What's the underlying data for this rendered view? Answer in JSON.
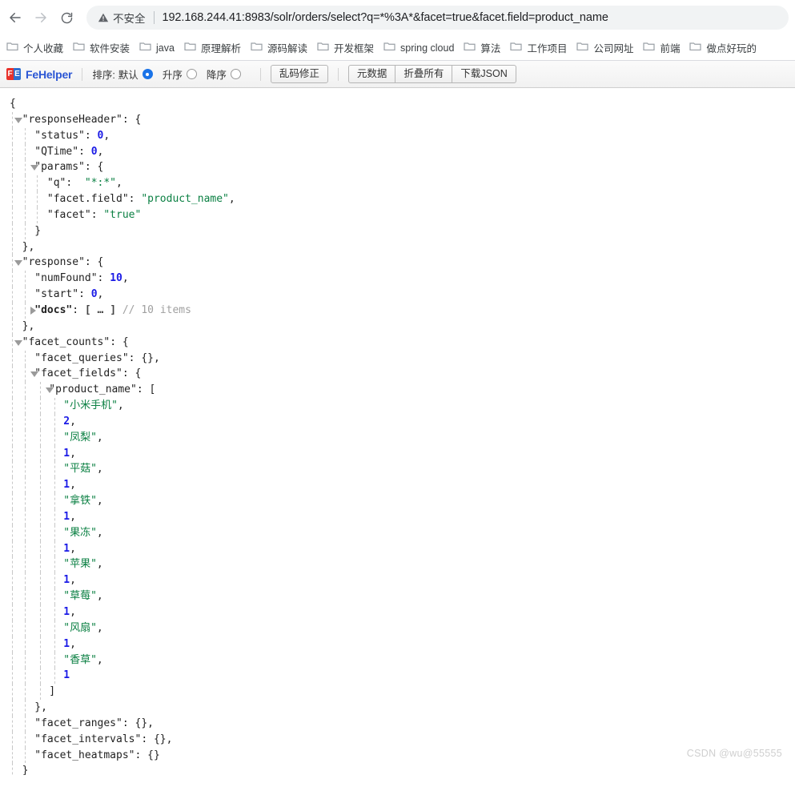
{
  "browser": {
    "back_icon": "back-arrow-icon",
    "forward_icon": "forward-arrow-icon",
    "reload_icon": "reload-icon",
    "security_text": "不安全",
    "url": "192.168.244.41:8983/solr/orders/select?q=*%3A*&facet=true&facet.field=product_name",
    "url_host": "192.168.244.41",
    "url_rest": ":8983/solr/orders/select?q=*%3A*&facet=true&facet.field=product_name"
  },
  "bookmarks": [
    {
      "label": "个人收藏"
    },
    {
      "label": "软件安装"
    },
    {
      "label": "java"
    },
    {
      "label": "原理解析"
    },
    {
      "label": "源码解读"
    },
    {
      "label": "开发框架"
    },
    {
      "label": "spring cloud"
    },
    {
      "label": "算法"
    },
    {
      "label": "工作项目"
    },
    {
      "label": "公司网址"
    },
    {
      "label": "前端"
    },
    {
      "label": "做点好玩的"
    }
  ],
  "fehelper": {
    "logo_f": "F",
    "logo_e": "E",
    "brand": "FeHelper",
    "sort_label": "排序:",
    "sort_options": [
      {
        "label": "默认",
        "checked": true
      },
      {
        "label": "升序",
        "checked": false
      },
      {
        "label": "降序",
        "checked": false
      }
    ],
    "fix_button": "乱码修正",
    "buttons": [
      {
        "label": "元数据"
      },
      {
        "label": "折叠所有"
      },
      {
        "label": "下载JSON"
      }
    ]
  },
  "json": {
    "response_header_key": "\"responseHeader\"",
    "status_key": "\"status\"",
    "status_value": "0",
    "qtime_key": "\"QTime\"",
    "qtime_value": "0",
    "params_key": "\"params\"",
    "q_key": "\"q\"",
    "q_value": "\"*:*\"",
    "facet_field_key": "\"facet.field\"",
    "facet_field_value": "\"product_name\"",
    "facet_key": "\"facet\"",
    "facet_value": "\"true\"",
    "response_key": "\"response\"",
    "num_found_key": "\"numFound\"",
    "num_found_value": "10",
    "start_key": "\"start\"",
    "start_value": "0",
    "docs_key": "\"docs\"",
    "docs_collapsed": "[ … ]",
    "docs_comment": "// 10 items",
    "facet_counts_key": "\"facet_counts\"",
    "facet_queries_key": "\"facet_queries\"",
    "facet_queries_value": "{},",
    "facet_fields_key": "\"facet_fields\"",
    "product_name_key": "\"product_name\"",
    "facet_ranges_key": "\"facet_ranges\"",
    "facet_ranges_value": "{},",
    "facet_intervals_key": "\"facet_intervals\"",
    "facet_intervals_value": "{},",
    "facet_heatmaps_key": "\"facet_heatmaps\"",
    "facet_heatmaps_value": "{}"
  },
  "facet_values": [
    {
      "name": "\"小米手机\"",
      "count": "2"
    },
    {
      "name": "\"凤梨\"",
      "count": "1"
    },
    {
      "name": "\"平菇\"",
      "count": "1"
    },
    {
      "name": "\"拿铁\"",
      "count": "1"
    },
    {
      "name": "\"果冻\"",
      "count": "1"
    },
    {
      "name": "\"苹果\"",
      "count": "1"
    },
    {
      "name": "\"草莓\"",
      "count": "1"
    },
    {
      "name": "\"风扇\"",
      "count": "1"
    },
    {
      "name": "\"香草\"",
      "count": "1"
    }
  ],
  "watermark": "CSDN @wu@55555"
}
